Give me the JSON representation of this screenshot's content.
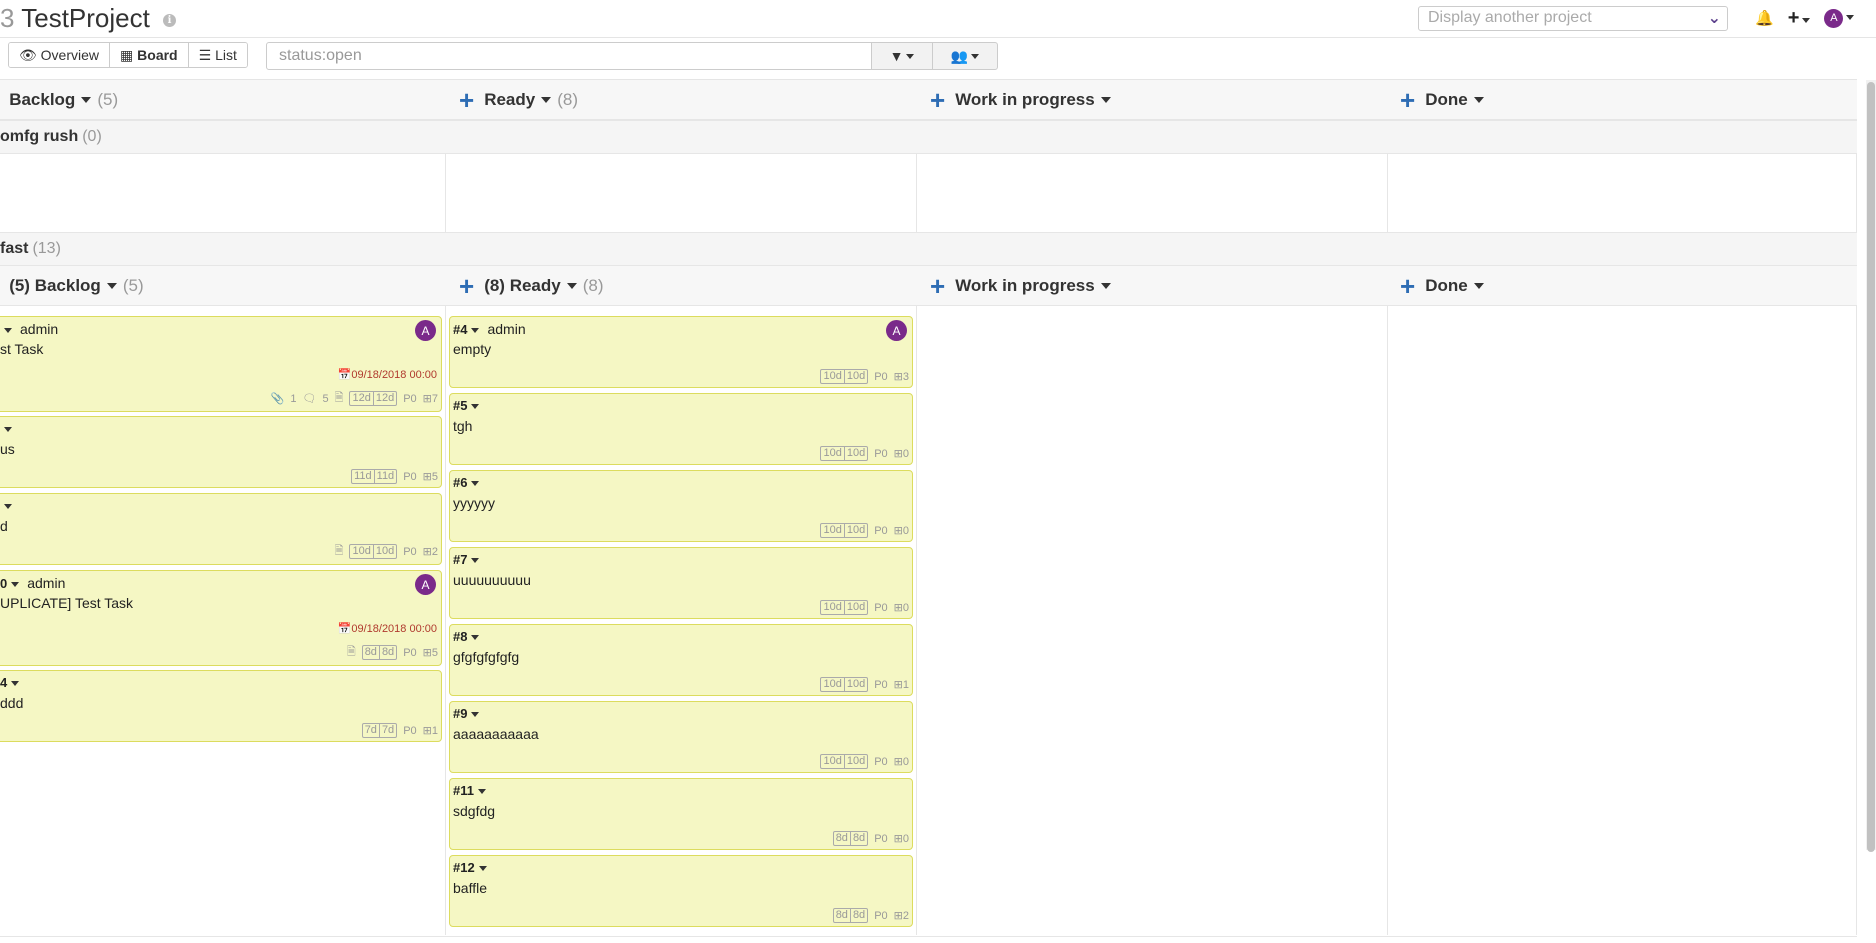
{
  "header": {
    "prefix": "3",
    "title": "TestProject",
    "project_select_placeholder": "Display another project",
    "avatar": "A"
  },
  "toolbar": {
    "views": [
      "Overview",
      "Board",
      "List"
    ],
    "filter_value": "status:open"
  },
  "columns": [
    {
      "name": "Backlog",
      "count": "(5)"
    },
    {
      "name": "Ready",
      "count": "(8)"
    },
    {
      "name": "Work in progress",
      "count": ""
    },
    {
      "name": "Done",
      "count": ""
    }
  ],
  "lanes": [
    {
      "name": "omfg rush",
      "count": "(0)"
    },
    {
      "name": "fast",
      "count": "(13)"
    }
  ],
  "lane2_columns": [
    {
      "name": "(5) Backlog",
      "count": "(5)"
    },
    {
      "name": "(8) Ready",
      "count": "(8)"
    },
    {
      "name": "Work in progress",
      "count": ""
    },
    {
      "name": "Done",
      "count": ""
    }
  ],
  "backlog_cards": [
    {
      "id": "",
      "owner": "admin",
      "title": "st Task",
      "avatar": "A",
      "due": "09/18/2018 00:00",
      "attach": "1",
      "comments": "5",
      "est": [
        "12d",
        "12d"
      ],
      "prio": "P0",
      "sub": "7"
    },
    {
      "id": "",
      "owner": "",
      "title": "us",
      "avatar": "",
      "due": "",
      "est": [
        "11d",
        "11d"
      ],
      "prio": "P0",
      "sub": "5"
    },
    {
      "id": "",
      "owner": "",
      "title": "d",
      "avatar": "",
      "due": "",
      "est": [
        "10d",
        "10d"
      ],
      "prio": "P0",
      "sub": "2"
    },
    {
      "id": "0",
      "owner": "admin",
      "title": "UPLICATE] Test Task",
      "avatar": "A",
      "due": "09/18/2018 00:00",
      "est": [
        "8d",
        "8d"
      ],
      "prio": "P0",
      "sub": "5"
    },
    {
      "id": "4",
      "owner": "",
      "title": "ddd",
      "avatar": "",
      "due": "",
      "est": [
        "7d",
        "7d"
      ],
      "prio": "P0",
      "sub": "1"
    }
  ],
  "ready_cards": [
    {
      "id": "#4",
      "owner": "admin",
      "title": "empty",
      "avatar": "A",
      "est": [
        "10d",
        "10d"
      ],
      "prio": "P0",
      "sub": "3"
    },
    {
      "id": "#5",
      "owner": "",
      "title": "tgh",
      "avatar": "",
      "est": [
        "10d",
        "10d"
      ],
      "prio": "P0",
      "sub": "0"
    },
    {
      "id": "#6",
      "owner": "",
      "title": "yyyyyy",
      "avatar": "",
      "est": [
        "10d",
        "10d"
      ],
      "prio": "P0",
      "sub": "0"
    },
    {
      "id": "#7",
      "owner": "",
      "title": "uuuuuuuuuu",
      "avatar": "",
      "est": [
        "10d",
        "10d"
      ],
      "prio": "P0",
      "sub": "0"
    },
    {
      "id": "#8",
      "owner": "",
      "title": "gfgfgfgfgfg",
      "avatar": "",
      "est": [
        "10d",
        "10d"
      ],
      "prio": "P0",
      "sub": "1"
    },
    {
      "id": "#9",
      "owner": "",
      "title": "aaaaaaaaaaa",
      "avatar": "",
      "est": [
        "10d",
        "10d"
      ],
      "prio": "P0",
      "sub": "0"
    },
    {
      "id": "#11",
      "owner": "",
      "title": "sdgfdg",
      "avatar": "",
      "est": [
        "8d",
        "8d"
      ],
      "prio": "P0",
      "sub": "0"
    },
    {
      "id": "#12",
      "owner": "",
      "title": "baffle",
      "avatar": "",
      "est": [
        "8d",
        "8d"
      ],
      "prio": "P0",
      "sub": "2"
    }
  ]
}
